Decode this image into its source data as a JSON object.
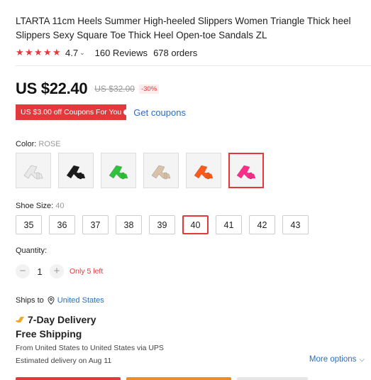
{
  "product": {
    "title": "LTARTA 11cm Heels Summer High-heeled Slippers Women Triangle Thick heel Slippers Sexy Square Toe Thick Heel Open-toe Sandals ZL",
    "rating": "4.7",
    "reviews": "160 Reviews",
    "orders": "678 orders"
  },
  "price": {
    "current": "US $22.40",
    "original": "US $32.00",
    "discount": "-30%"
  },
  "coupon": {
    "label": "US $3.00 off Coupons For You",
    "action": "Get coupons"
  },
  "color": {
    "label": "Color:",
    "selected": "ROSE",
    "swatches": [
      {
        "name": "white",
        "hex": "#e9e9e9"
      },
      {
        "name": "black",
        "hex": "#1c1c1c"
      },
      {
        "name": "green",
        "hex": "#2fc33d"
      },
      {
        "name": "nude",
        "hex": "#d9c2a9"
      },
      {
        "name": "orange",
        "hex": "#ff5a1a"
      },
      {
        "name": "rose",
        "hex": "#ff2d8a"
      }
    ]
  },
  "size": {
    "label": "Shoe Size:",
    "selected": "40",
    "options": [
      "35",
      "36",
      "37",
      "38",
      "39",
      "40",
      "41",
      "42",
      "43"
    ]
  },
  "quantity": {
    "label": "Quantity:",
    "value": "1",
    "minus": "−",
    "plus": "+",
    "stock": "Only 5 left"
  },
  "shipping": {
    "ships_to": "Ships to",
    "country": "United States",
    "delivery": "7-Day Delivery",
    "free": "Free Shipping",
    "route": "From United States to United States via UPS",
    "estimate": "Estimated delivery on Aug 11",
    "more": "More options"
  },
  "colors": {
    "accent": "#e4393c",
    "link": "#2a6ebf",
    "warning": "#f08b2b"
  }
}
